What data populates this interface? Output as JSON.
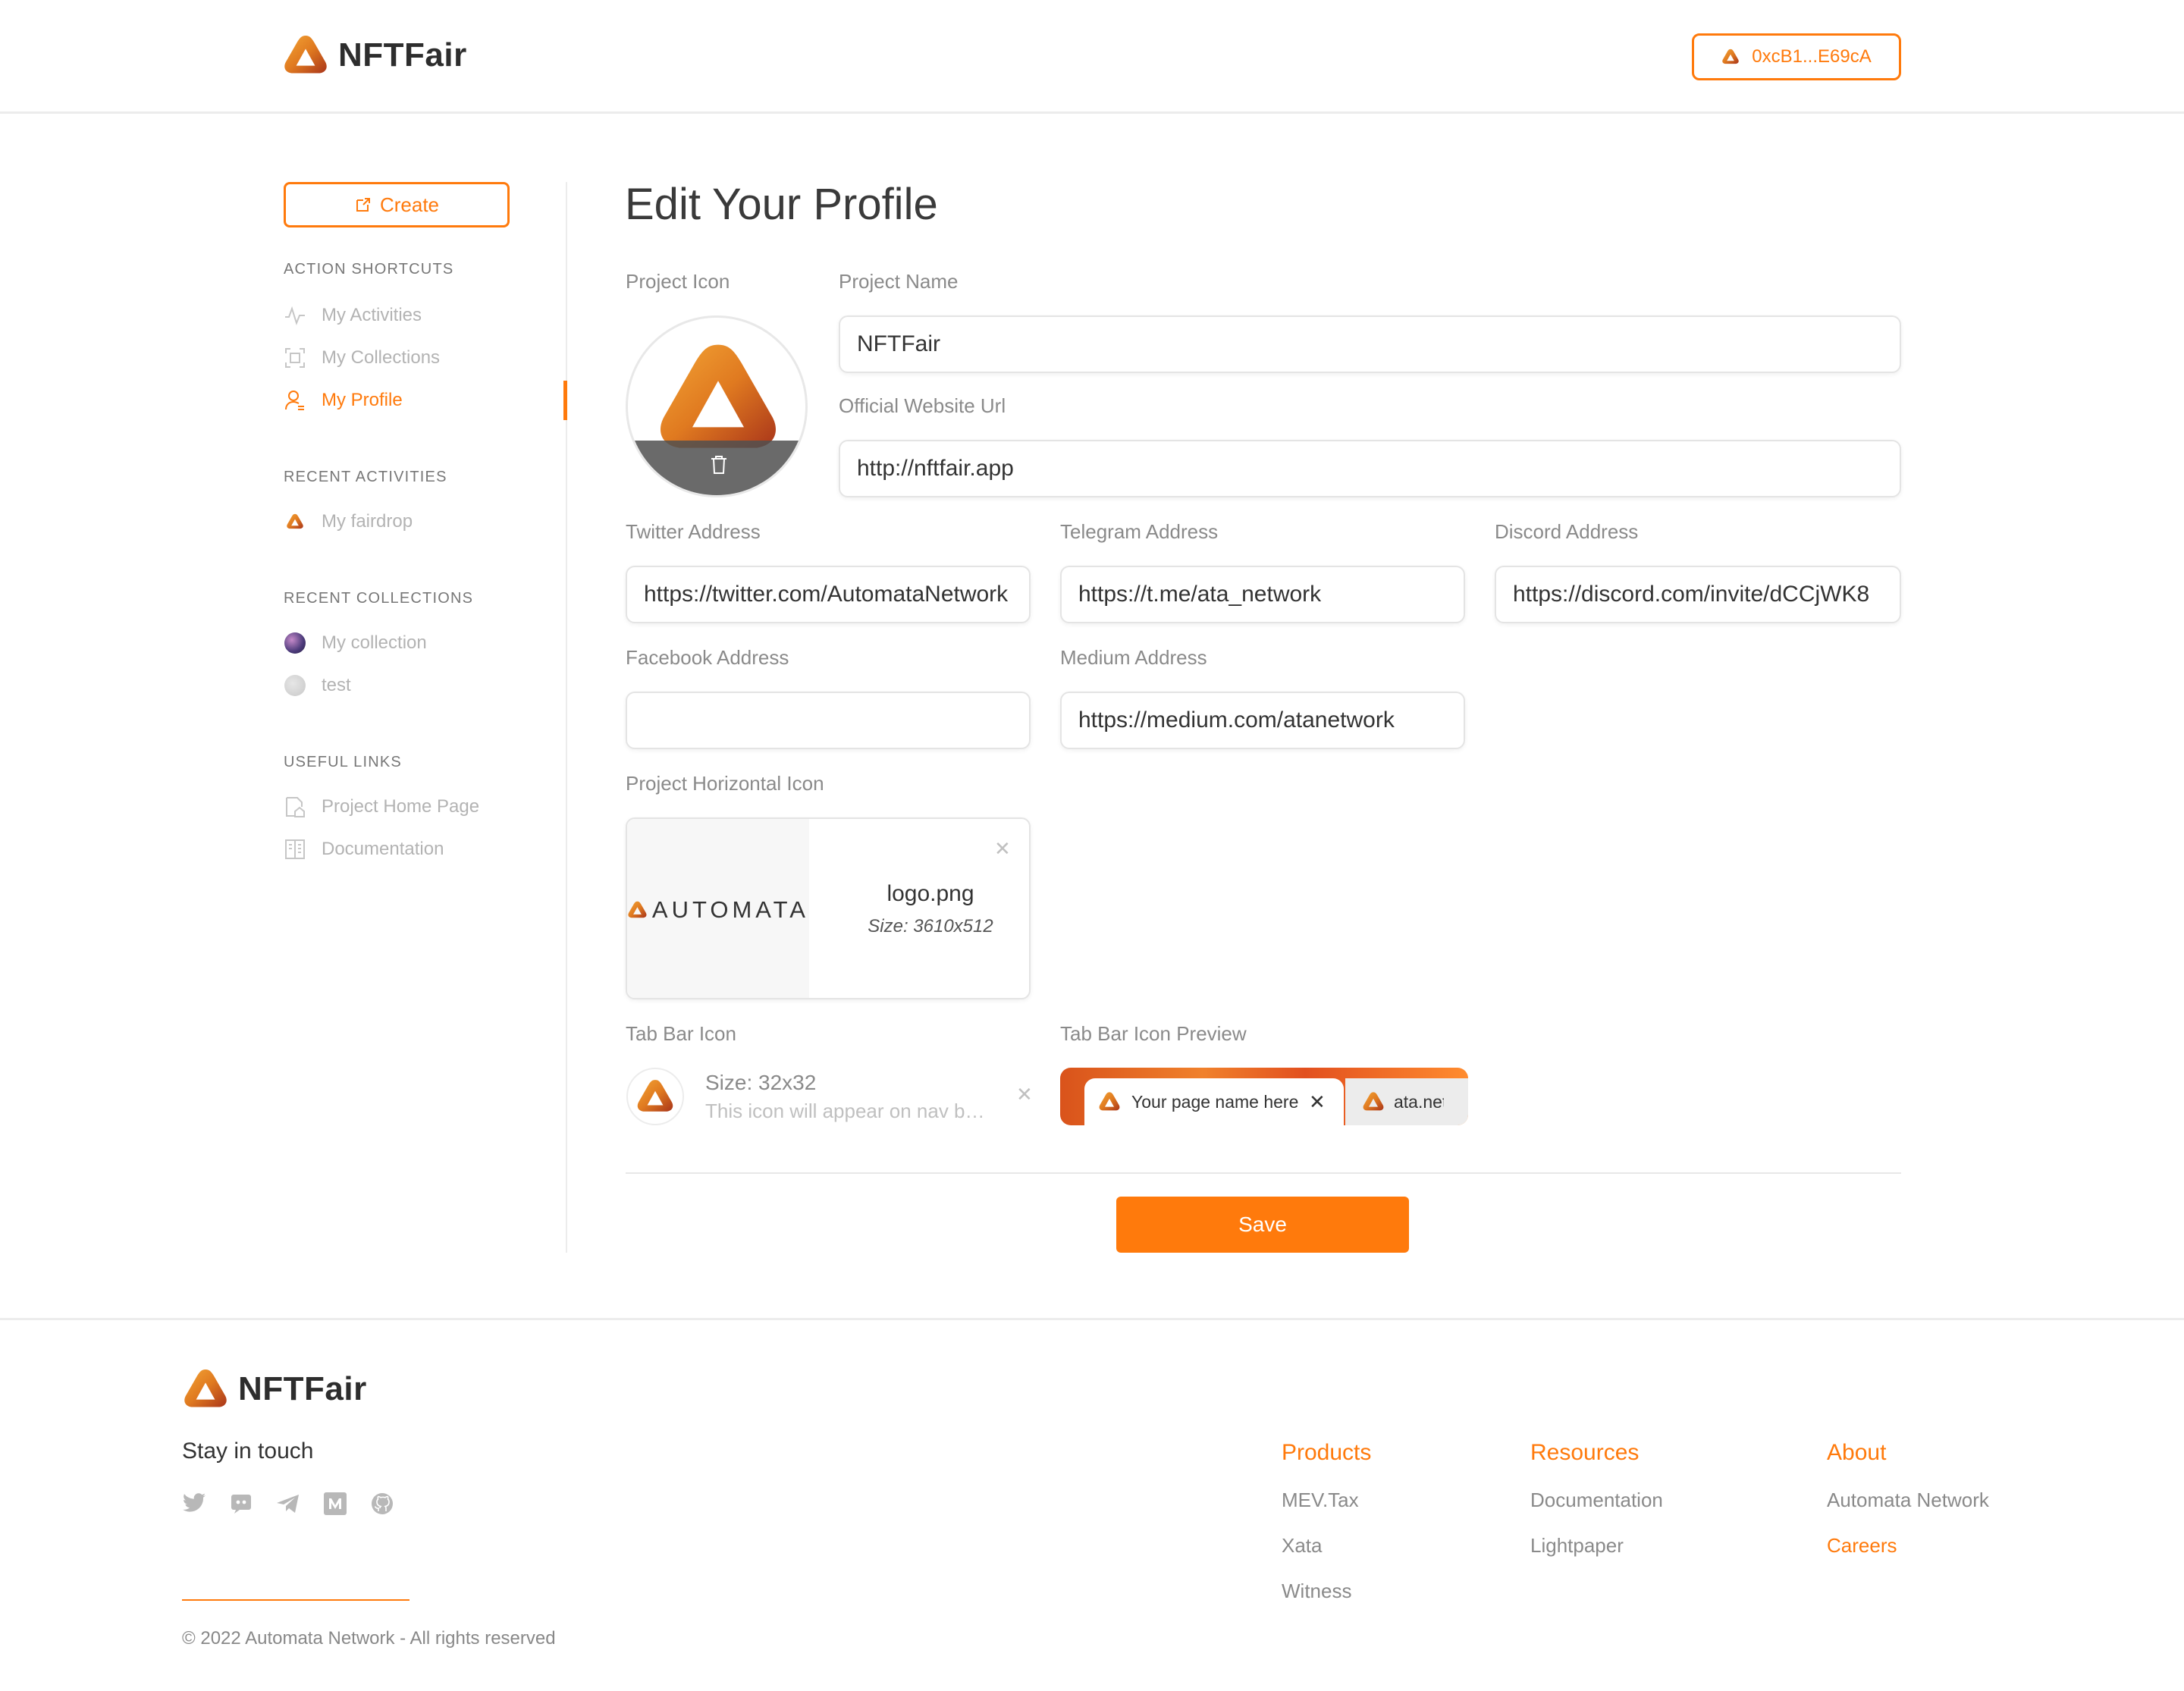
{
  "brand": {
    "name": "NFTFair",
    "accent": "#ff7a0c"
  },
  "header": {
    "wallet_address": "0xcB1...E69cA"
  },
  "sidebar": {
    "create_label": "Create",
    "sections": {
      "action_shortcuts": "ACTION SHORTCUTS",
      "recent_activities": "RECENT ACTIVITIES",
      "recent_collections": "RECENT COLLECTIONS",
      "useful_links": "USEFUL LINKS"
    },
    "shortcuts": [
      {
        "label": "My Activities",
        "icon": "activity-icon"
      },
      {
        "label": "My Collections",
        "icon": "collections-icon"
      },
      {
        "label": "My Profile",
        "icon": "user-icon"
      }
    ],
    "activities": [
      {
        "label": "My fairdrop",
        "icon": "automata-logo-icon"
      }
    ],
    "collections": [
      {
        "label": "My collection",
        "icon": "collection-avatar"
      },
      {
        "label": "test",
        "icon": "collection-avatar"
      }
    ],
    "links": [
      {
        "label": "Project Home Page",
        "icon": "home-page-icon"
      },
      {
        "label": "Documentation",
        "icon": "documentation-icon"
      }
    ]
  },
  "form": {
    "title": "Edit Your Profile",
    "project_icon_label": "Project Icon",
    "project_name_label": "Project Name",
    "project_name": "NFTFair",
    "website_label": "Official Website Url",
    "website": "http://nftfair.app",
    "twitter_label": "Twitter Address",
    "twitter": "https://twitter.com/AutomataNetwork",
    "telegram_label": "Telegram Address",
    "telegram": "https://t.me/ata_network",
    "discord_label": "Discord Address",
    "discord": "https://discord.com/invite/dCCjWK8",
    "facebook_label": "Facebook Address",
    "facebook": "",
    "medium_label": "Medium Address",
    "medium": "https://medium.com/atanetwork",
    "horizontal_icon_label": "Project Horizontal Icon",
    "horizontal_icon": {
      "logo_text": "AUTOMATA",
      "file_name": "logo.png",
      "size": "Size: 3610x512"
    },
    "tab_bar_icon_label": "Tab Bar Icon",
    "tab_bar_icon": {
      "size": "Size: 32x32",
      "description": "This icon will appear on nav bar and browser tab"
    },
    "tab_preview_label": "Tab Bar Icon Preview",
    "tab_preview": {
      "tab1": "Your page name here",
      "tab2": "ata.network"
    },
    "save_label": "Save"
  },
  "footer": {
    "brand": "NFTFair",
    "stay_in_touch": "Stay in touch",
    "social": [
      "twitter-icon",
      "discord-icon",
      "telegram-icon",
      "medium-icon",
      "github-icon"
    ],
    "columns": [
      {
        "title": "Products",
        "links": [
          "MEV.Tax",
          "Xata",
          "Witness"
        ]
      },
      {
        "title": "Resources",
        "links": [
          "Documentation",
          "Lightpaper"
        ]
      },
      {
        "title": "About",
        "links": [
          "Automata Network",
          "Careers"
        ]
      }
    ],
    "copyright": "© 2022 Automata Network - All rights reserved"
  }
}
